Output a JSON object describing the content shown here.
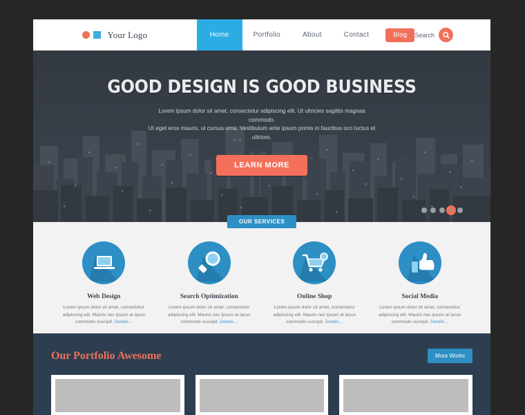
{
  "colors": {
    "page_bg": "#262626",
    "accent_orange": "#f1705a",
    "accent_blue": "#2bade3",
    "services_blue": "#2d8fc4",
    "portfolio_bg": "#2d3e50",
    "services_bg": "#f2f2f2"
  },
  "header": {
    "logo": {
      "text": "Your Logo",
      "dot_icon": "circle-icon",
      "square_icon": "square-icon"
    },
    "nav": [
      {
        "label": "Home",
        "active": true
      },
      {
        "label": "Portfolio",
        "active": false
      },
      {
        "label": "About",
        "active": false
      },
      {
        "label": "Contact",
        "active": false
      }
    ],
    "blog_label": "Blog",
    "search_label": "Search",
    "search_icon": "magnifier-icon"
  },
  "hero": {
    "title": "GOOD DESIGN IS GOOD BUSINESS",
    "subtitle_line1": "Lorem ipsum dolor sit amet, consectetur adipiscing elit. Ut ultricies sagittis magnaa commodo.",
    "subtitle_line2": "Ut eget eros mauris, ut cursus urna. Vestibulum ante ipsum primis in faucibus orci luctus et ultrices.",
    "button_label": "LEARN MORE",
    "slider_dot_count": 5,
    "slider_active_index": 3
  },
  "services": {
    "badge": "OUR SERVICES",
    "items": [
      {
        "title": "Web Design",
        "icon": "laptop-icon",
        "desc": "Lorem ipsum dolor sit amet, consectetur adipiscing elit. Mauris nec ipsum at lacus commodo suscipit. ",
        "link": "Details..."
      },
      {
        "title": "Search Optimization",
        "icon": "magnifier-icon",
        "desc": "Lorem ipsum dolor sit amet, consectetur adipiscing elit. Mauris nec ipsum at lacus commodo suscipit. ",
        "link": "Details..."
      },
      {
        "title": "Online Shop",
        "icon": "shopping-cart-icon",
        "desc": "Lorem ipsum dolor sit amet, consectetur adipiscing elit. Mauris nec ipsum at lacus commodo suscipit. ",
        "link": "Details..."
      },
      {
        "title": "Social Media",
        "icon": "thumbs-up-icon",
        "desc": "Lorem ipsum dolor sit amet, consectetur adipiscing elit. Mauris nec ipsum at lacus commodo suscipit. ",
        "link": "Details..."
      }
    ]
  },
  "portfolio": {
    "title": "Our Portfolio Awesome",
    "button_label": "More Works",
    "items": [
      {
        "name": "portfolio-thumb-1"
      },
      {
        "name": "portfolio-thumb-2"
      },
      {
        "name": "portfolio-thumb-3"
      }
    ]
  }
}
